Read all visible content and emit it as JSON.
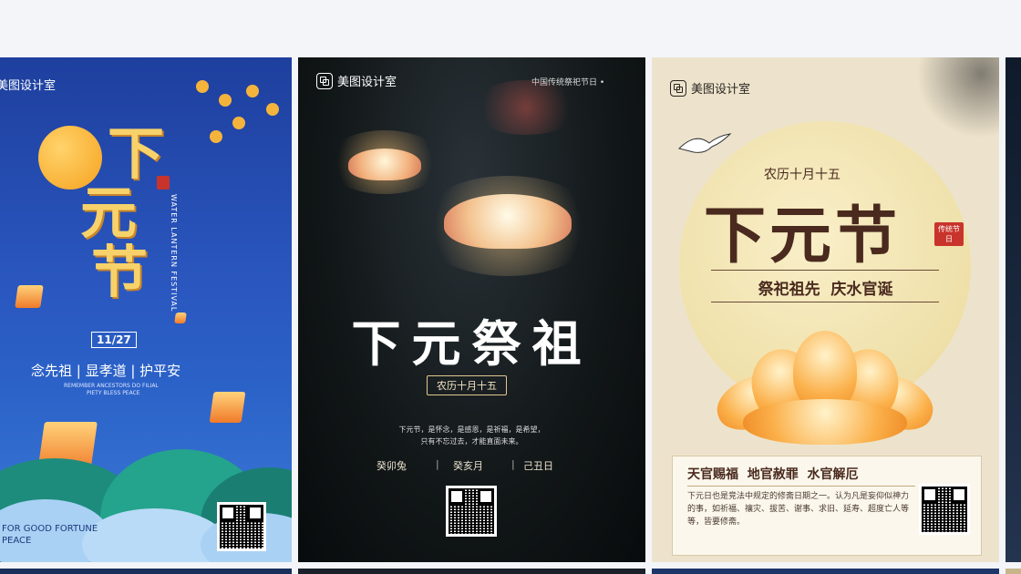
{
  "gallery": {
    "card1": {
      "brand": "美图设计室",
      "title_chars": [
        "下",
        "元",
        "节"
      ],
      "english_vertical": "WATER LANTERN FESTIVAL",
      "date": "11/27",
      "tagline": "念先祖 | 显孝道 | 护平安",
      "english_line1": "REMEMBER ANCESTORS DO FILIAL",
      "english_line2": "PIETY BLESS PEACE",
      "footer_line1": "FOR GOOD FORTUNE",
      "footer_line2": "PEACE",
      "colors": {
        "bg": "#2a57bf",
        "accent": "#f7d26a"
      }
    },
    "card2": {
      "brand": "美图设计室",
      "top_right": "中国传统祭祀节日 •",
      "title": "下元祭祖",
      "date_badge": "农历十月十五",
      "ganzhi": [
        "癸卯兔",
        "癸亥月",
        "己丑日"
      ],
      "separator": "|",
      "desc_line1": "下元节，是怀念，是感恩，是祈福，是希望，",
      "desc_line2": "只有不忘过去，才能直面未来。",
      "colors": {
        "bg": "#111617",
        "text": "#ffffff"
      }
    },
    "card3": {
      "brand": "美图设计室",
      "lunar_date": "农历十月十五",
      "title": "下元节",
      "seal": "传统节日",
      "subtitle": "祭祀祖先  庆水官诞",
      "box_title": "天官赐福  地官赦罪  水官解厄",
      "box_text": "下元日也是竞法中规定的修斋日期之一。认为凡是妄仰似神力的事，如祈福、禳灾、拔苦、谢事、求旧、延寿、超度亡人等等，皆要修斋。",
      "colors": {
        "bg": "#ede3cc",
        "title": "#4a2a1e"
      }
    }
  }
}
